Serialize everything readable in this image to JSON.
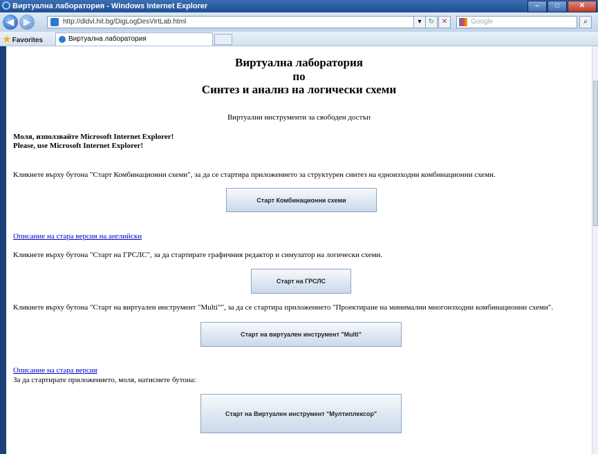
{
  "window": {
    "title": "Виртуална лаборатория - Windows Internet Explorer"
  },
  "toolbar": {
    "address": "http://dldvl.hit.bg/DigLogDesVirtLab.html",
    "search_placeholder": "Google"
  },
  "favbar": {
    "favorites_label": "Favorites",
    "tab_label": "Виртуална лаборатория"
  },
  "page": {
    "title_line1": "Виртуална лаборатория",
    "title_line2": "по",
    "title_line3": "Синтез и анализ на логически схеми",
    "subtitle": "Виртуални инструменти за свободен достъп",
    "warning_bg": "Моля, използвайте Microsoft Internet Explorer!",
    "warning_en": "Please, use Microsoft Internet Explorer!",
    "text1": "Кликнете върху бутона \"Старт Комбинационни схеми\", за да се стартира приложението за структурен синтез на едноизходни комбинационни схеми.",
    "btn1": "Старт Комбинационни схеми",
    "link1": "Описание на стара версия на английски",
    "text2": "Кликнете върху бутона \"Старт на ГРСЛС\", за да стартирате графичния редактор и симулатор на логически схеми.",
    "btn2": "Старт на ГРСЛС",
    "text3": "Кликнете върху бутона \"Старт на виртуален инструмент \"Multi\"\", за да се стартира приложението \"Проектиране на минимални многоизходни комбинационни схеми\".",
    "btn3": "Старт на виртуален инструмент  \"Multi\"",
    "link2": "Описание на стара версия",
    "text4": "За да стартирате приложението, моля, натиснете бутона:",
    "btn4": "Старт на Виртуален инструмент \"Мултиплексор\""
  }
}
